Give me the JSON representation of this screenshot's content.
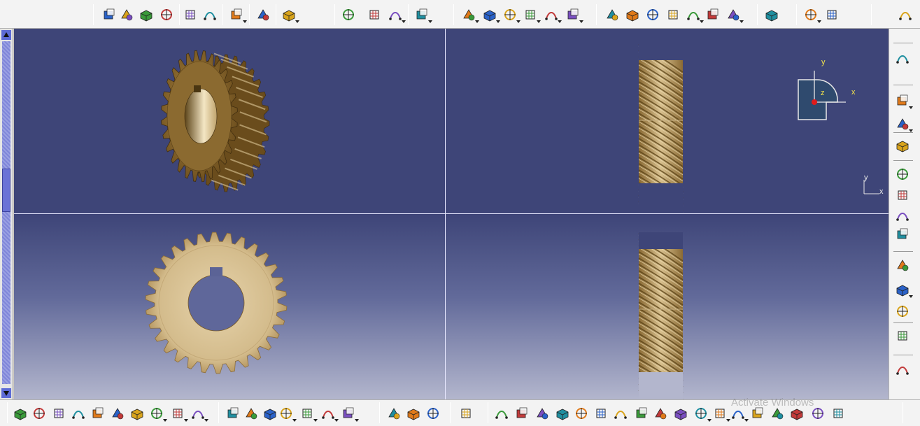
{
  "app": {
    "name": "3D CAD part design workspace",
    "colors": {
      "viewport_bg_top": "#3e4578",
      "viewport_bg_bottom": "#b3b6cd",
      "toolbar_bg": "#f3f3f3",
      "gear_light": "#d9c29a",
      "gear_dark": "#7a5a24",
      "compass_axis": "#f2e24a",
      "compass_origin": "#e21b1b"
    }
  },
  "top_toolbar": {
    "icons": [
      "point-icon",
      "spline-icon",
      "circle-icon",
      "plane-icon",
      "pad-icon",
      "pocket-icon",
      "shaft-icon",
      "pattern-icon",
      "snap-icon",
      "extract-icon",
      "join-icon",
      "grid-icon",
      "select-icon",
      "box-icon",
      "cylinder-icon",
      "hole-icon",
      "fillet-icon",
      "chamfer-icon",
      "draft-icon",
      "material-icon",
      "shell-icon",
      "thickness-icon",
      "surface-icon",
      "boolean-icon",
      "measure-icon",
      "catalog-icon",
      "analysis-icon",
      "parameter-icon",
      "line-icon"
    ]
  },
  "right_toolbar": {
    "icons": [
      "product-icon",
      "abc-text-icon",
      "arrow-flag-icon",
      "assembly-icon",
      "part-body-icon",
      "layer-icon",
      "eraser-icon",
      "book-icon",
      "add-component-icon",
      "replace-component-icon",
      "rotate-components-icon",
      "constraint-icon",
      "pdf-export-icon"
    ]
  },
  "bottom_toolbar": {
    "icons": [
      "new-file-icon",
      "open-folder-icon",
      "save-icon",
      "print-icon",
      "cut-icon",
      "copy-icon",
      "paste-icon",
      "undo-icon",
      "redo-icon",
      "help-icon",
      "formula-icon",
      "comment-icon",
      "light-icon",
      "table-icon",
      "tree-icon",
      "lock-icon",
      "tolerance-icon",
      "ruler-icon",
      "fix-icon",
      "weight-icon",
      "camera-icon",
      "fly-icon",
      "fit-all-icon",
      "pan-icon",
      "rotate-icon",
      "zoom-in-icon",
      "zoom-out-icon",
      "normal-view-icon",
      "orange-cube-icon",
      "iso-view-icon",
      "cylinder-view-icon",
      "shading-icon",
      "render-icon",
      "hide-show-icon",
      "swap-visible-icon",
      "edges-icon",
      "material-view-icon",
      "refresh-icon",
      "earth-icon"
    ]
  },
  "watermark_text": "Activate Windows",
  "compass": {
    "axis_y": "y",
    "axis_z": "z",
    "axis_x": "x"
  },
  "mini_axes": {
    "axis_y": "y",
    "axis_x": "x"
  },
  "viewports": [
    {
      "name": "isometric-view",
      "object": "helical gear"
    },
    {
      "name": "side-view",
      "object": "helical gear"
    },
    {
      "name": "front-view",
      "object": "helical gear"
    },
    {
      "name": "side-view-2",
      "object": "helical gear"
    }
  ]
}
